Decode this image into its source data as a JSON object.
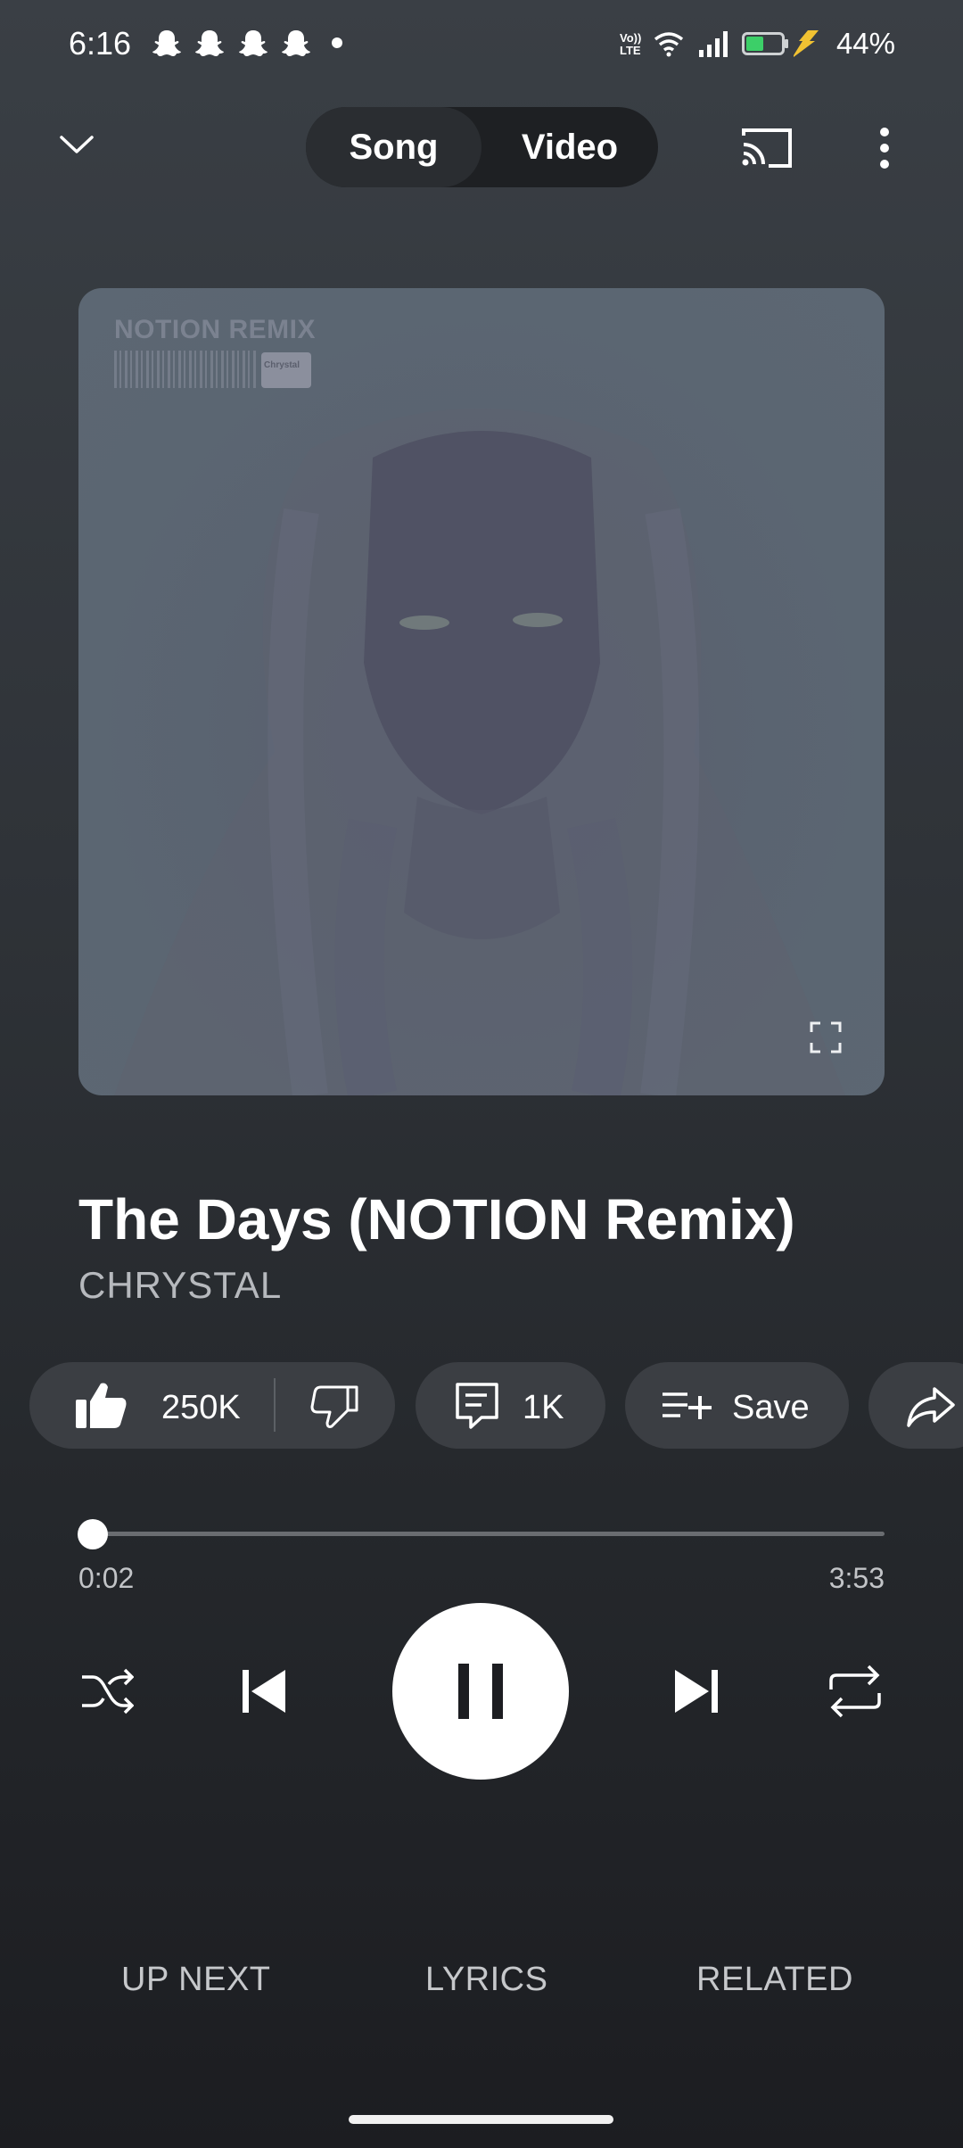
{
  "status_bar": {
    "time": "6:16",
    "battery_percent": "44%",
    "network_label_top": "Vo))",
    "network_label_bottom": "LTE",
    "notification_icons": [
      "snapchat-icon",
      "snapchat-icon",
      "snapchat-icon",
      "snapchat-icon"
    ]
  },
  "header": {
    "segment_song": "Song",
    "segment_video": "Video",
    "active_segment": "Song"
  },
  "artwork": {
    "overlay_title": "NOTION REMIX",
    "badge_text": "Chrystal"
  },
  "track": {
    "title": "The Days (NOTION Remix)",
    "artist": "CHRYSTAL"
  },
  "actions": {
    "likes": "250K",
    "comments": "1K",
    "save_label": "Save"
  },
  "progress": {
    "elapsed": "0:02",
    "duration": "3:53",
    "fraction": 0.009
  },
  "tabs": {
    "up_next": "UP NEXT",
    "lyrics": "LYRICS",
    "related": "RELATED"
  },
  "colors": {
    "background_top": "#3a3f45",
    "background_bottom": "#1c1d21",
    "chip": "#3b3e43",
    "artwork_tint": "#5b6672"
  }
}
